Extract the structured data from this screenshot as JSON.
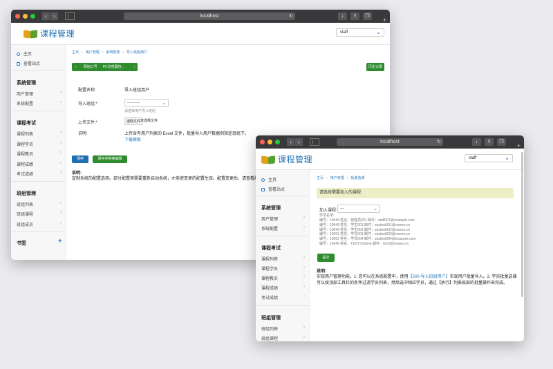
{
  "w1": {
    "url": "localhost",
    "logo": "课程管理",
    "user": "staff",
    "side_top": [
      "主页",
      "查看站点"
    ],
    "sec1": {
      "title": "系统管理",
      "items": [
        "用户管理",
        "系统配置"
      ]
    },
    "sec2": {
      "title": "课程考试",
      "items": [
        "课程列表",
        "课程学员",
        "课程教员",
        "课程成绩",
        "考试成绩"
      ]
    },
    "sec3": {
      "title": "班组管理",
      "items": [
        "班组列表",
        "班组课程",
        "班组成员"
      ]
    },
    "sec4": {
      "title": "书签"
    },
    "bc": [
      "主页",
      "用户管理",
      "系统配置",
      "导入班组用户"
    ],
    "tabs": [
      "网站口号",
      "PC浏览器自..."
    ],
    "history": "历史记录",
    "f1_label": "配置名称:",
    "f1_value": "导入班组用户",
    "f2_label": "导入班组:*",
    "f2_value": "---------",
    "f2_help": "请选择用户导入班组",
    "f3_label": "上传文件:*",
    "f3_btn": "选取文件",
    "f3_value": "未选择文件",
    "f4_label": "说明:",
    "f4_value": "上传含有用户列表的 Excel 文件，批量导入用户数据到指定班组下。",
    "f4_link": "下载模板",
    "save": "保存",
    "save_cont": "保存并继续编辑",
    "note_title": "说明:",
    "note_text": "定制系统的配置选项。部分配置项需要重新启动系统，才能使变更的配置生效。配置变更后，请查看配置列表"
  },
  "w2": {
    "url": "localhost",
    "logo": "课程管理",
    "user": "staff",
    "side_top": [
      "主页",
      "查看站点"
    ],
    "sec1": {
      "title": "系统管理",
      "items": [
        "用户管理",
        "系统配置"
      ]
    },
    "sec2": {
      "title": "课程考试",
      "items": [
        "课程列表",
        "课程学员",
        "课程教员",
        "课程成绩",
        "考试成绩"
      ]
    },
    "sec3": {
      "title": "班组管理",
      "items": [
        "班组列表",
        "班组课程"
      ]
    },
    "bc": [
      "主页",
      "用户管理",
      "批量选课"
    ],
    "alert": "请选择需要加入的课程:",
    "join_label": "加入课程:",
    "join_value": "---",
    "list_title": "学员名单:",
    "students": [
      "编号：10049 姓名：管理员001 邮件：staff001@example.com",
      "编号：10049 姓名：学生001 邮件：student001@noweo.cn",
      "编号：10049 姓名：学生002 邮件：student002@noweo.cn",
      "编号：10051 姓名：学员003 邮件：student003@noweo.cn",
      "编号：10052 姓名：学员004 邮件：student004@example.com",
      "编号：10048 姓名：TEST3 Name 邮件：test3@noweo.cn"
    ],
    "submit": "提交",
    "note_title": "说明:",
    "note_1": "实现用户管理功能。1. 您可以在系统配置中，使用",
    "note_link": "【500-导入班组用户】",
    "note_2": "实现用户批量导入。2. 学员批量选课可以按顶部工具栏的条件过滤学员列表，然后选中相应学员，通过【执行】列表底部的批量操作来完成。"
  }
}
